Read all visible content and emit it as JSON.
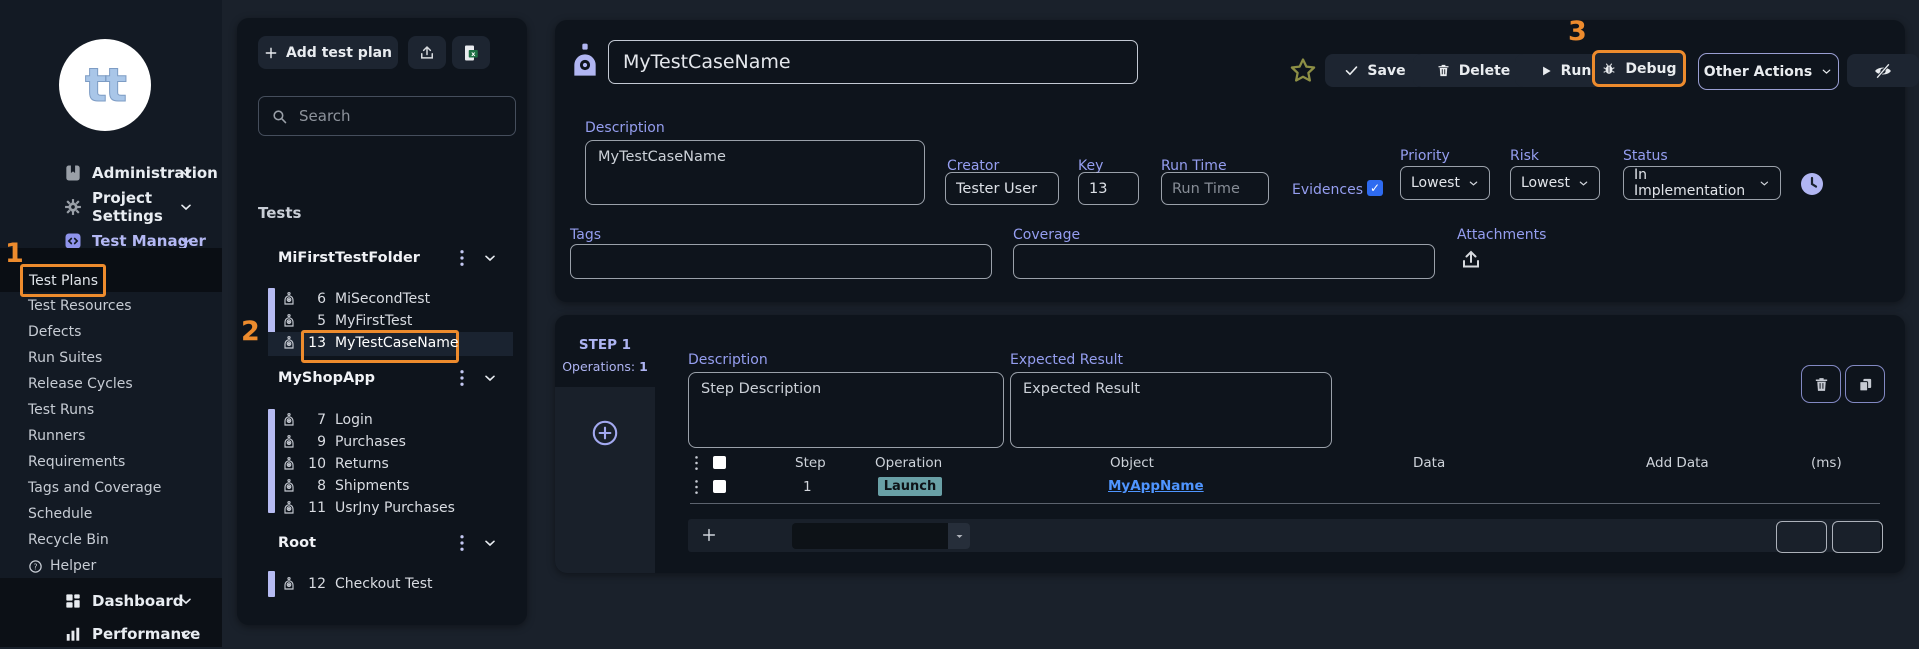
{
  "annotations": {
    "n1": "1",
    "n2": "2",
    "n3": "3"
  },
  "colors": {
    "accent_orange": "#ed8b2d",
    "lavender": "#b1b6f2",
    "label_purple": "#959ef0",
    "link_blue": "#4f95ff",
    "launch_teal": "#69a0a6",
    "checkbox_blue": "#2e6bf0"
  },
  "sidebar": {
    "logo": "tt",
    "nav": [
      {
        "label": "Administration"
      },
      {
        "label": "Project Settings"
      },
      {
        "label": "Test Manager"
      }
    ],
    "submenu": [
      "Test Plans",
      "Test Resources",
      "Defects",
      "Run Suites",
      "Release Cycles",
      "Test Runs",
      "Runners",
      "Requirements",
      "Tags and Coverage",
      "Schedule",
      "Recycle Bin",
      "Helper"
    ],
    "bottom": [
      "Dashboard",
      "Performance"
    ]
  },
  "panel": {
    "add_button": "Add test plan",
    "search_placeholder": "Search",
    "tests_label": "Tests",
    "folders": [
      {
        "name": "MiFirstTestFolder",
        "items": [
          {
            "id": "6",
            "name": "MiSecondTest"
          },
          {
            "id": "5",
            "name": "MyFirstTest"
          },
          {
            "id": "13",
            "name": "MyTestCaseName"
          }
        ]
      },
      {
        "name": "MyShopApp",
        "items": [
          {
            "id": "7",
            "name": "Login"
          },
          {
            "id": "9",
            "name": "Purchases"
          },
          {
            "id": "10",
            "name": "Returns"
          },
          {
            "id": "8",
            "name": "Shipments"
          },
          {
            "id": "11",
            "name": "UsrJny Purchases"
          }
        ]
      },
      {
        "name": "Root",
        "items": [
          {
            "id": "12",
            "name": "Checkout Test"
          }
        ]
      }
    ]
  },
  "editor": {
    "name_value": "MyTestCaseName",
    "toolbar": {
      "save": "Save",
      "delete": "Delete",
      "run": "Run",
      "debug": "Debug",
      "other_actions": "Other Actions"
    },
    "description_label": "Description",
    "description_value": "MyTestCaseName",
    "creator_label": "Creator",
    "creator_value": "Tester User",
    "key_label": "Key",
    "key_value": "13",
    "run_time_label": "Run Time",
    "run_time_placeholder": "Run Time",
    "evidences_label": "Evidences",
    "priority_label": "Priority",
    "priority_value": "Lowest",
    "risk_label": "Risk",
    "risk_value": "Lowest",
    "status_label": "Status",
    "status_value": "In Implementation",
    "tags_label": "Tags",
    "coverage_label": "Coverage",
    "attachments_label": "Attachments"
  },
  "step": {
    "title": "STEP 1",
    "operations_label": "Operations:",
    "operations_count": "1",
    "description_label": "Description",
    "description_value": "Step Description",
    "expected_label": "Expected Result",
    "expected_value": "Expected Result",
    "headers": {
      "step": "Step",
      "operation": "Operation",
      "object": "Object",
      "data": "Data",
      "add_data": "Add Data",
      "ms": "(ms)"
    },
    "rows": [
      {
        "step": "1",
        "operation": "Launch",
        "object": "MyAppName"
      }
    ]
  }
}
